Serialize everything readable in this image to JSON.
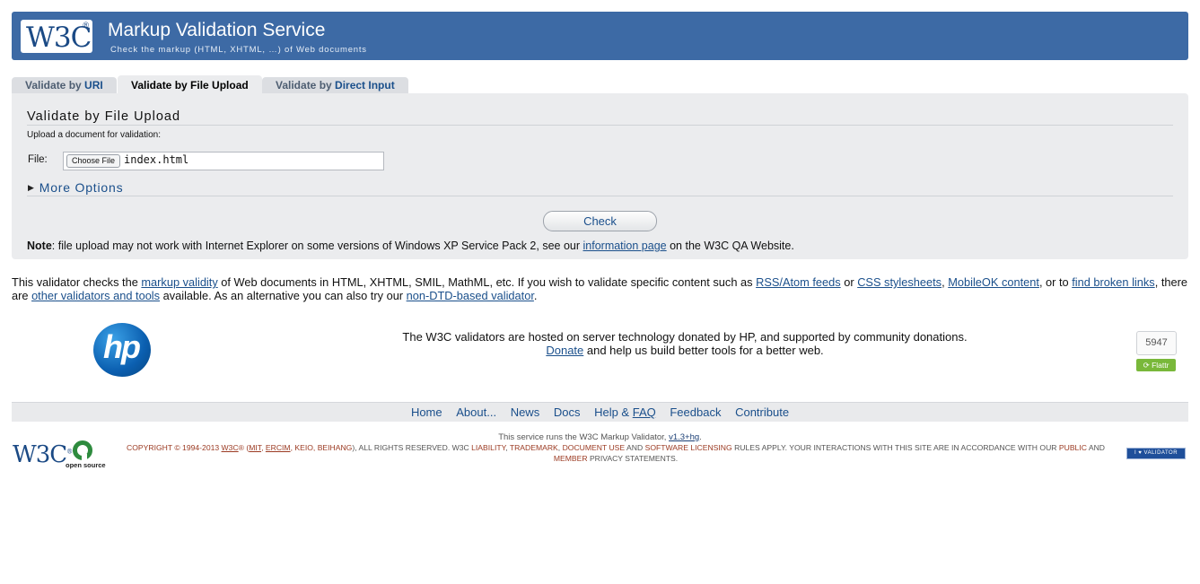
{
  "banner": {
    "logo_text": "W3C",
    "title": "Markup Validation Service",
    "subtitle": "Check the markup (HTML, XHTML, …) of Web documents"
  },
  "tabs": [
    {
      "prefix": "Validate by ",
      "name": "URI"
    },
    {
      "label": "Validate by File Upload"
    },
    {
      "prefix": "Validate by ",
      "name": "Direct Input"
    }
  ],
  "form": {
    "title": "Validate by File Upload",
    "description": "Upload a document for validation:",
    "file_label": "File:",
    "choose_button": "Choose File",
    "file_name": "index.html",
    "more_options": "More Options",
    "check_button": "Check"
  },
  "note": {
    "label": "Note",
    "text": ": file upload may not work with Internet Explorer on some versions of Windows XP Service Pack 2, see our ",
    "link": "information page",
    "suffix": " on the W3C QA Website."
  },
  "info": {
    "t1": "This validator checks the ",
    "l1": "markup validity",
    "t2": " of Web documents in HTML, XHTML, SMIL, MathML, etc. If you wish to validate specific content such as ",
    "l2": "RSS/Atom feeds",
    "t3": " or ",
    "l3": "CSS stylesheets",
    "t4": ", ",
    "l4": "MobileOK content",
    "t5": ", or to ",
    "l5": "find broken links",
    "t6": ", there are ",
    "l6": "other validators and tools",
    "t7": " available. As an alternative you can also try our ",
    "l7": "non-DTD-based validator",
    "t8": "."
  },
  "sponsor": {
    "logo_text": "hp",
    "line1": "The W3C validators are hosted on server technology donated by HP, and supported by community donations.",
    "donate": "Donate",
    "line2": " and help us build better tools for a better web.",
    "flattr_count": "5947",
    "flattr_label": "Flattr"
  },
  "footer_nav": {
    "home": "Home",
    "about": "About...",
    "news": "News",
    "docs": "Docs",
    "help": "Help & ",
    "faq": "FAQ",
    "feedback": "Feedback",
    "contribute": "Contribute"
  },
  "runs": {
    "text": "This service runs the W3C Markup Validator, ",
    "version": "v1.3+hg",
    "end": "."
  },
  "footer_logos": {
    "w3c": "W3C",
    "open_source": "open source"
  },
  "copyright": {
    "c1": "Copyright © 1994-2013 ",
    "c2": "W3C",
    "c3": "® (",
    "c4": "MIT",
    "c5": ", ",
    "c6": "ERCIM",
    "c7": ", ",
    "c8": "Keio",
    "c9": ", ",
    "c10": "Beihang",
    "c11": "), All Rights Reserved. W3C ",
    "c12": "liability",
    "c13": ", ",
    "c14": "trademark",
    "c15": ", ",
    "c16": "document use",
    "c17": " and ",
    "c18": "software licensing",
    "c19": " rules apply. Your interactions with this site are in accordance with our ",
    "c20": "public",
    "c21": " and ",
    "c22": "Member",
    "c23": " privacy statements."
  },
  "badge": "I ♥ VALIDATOR"
}
